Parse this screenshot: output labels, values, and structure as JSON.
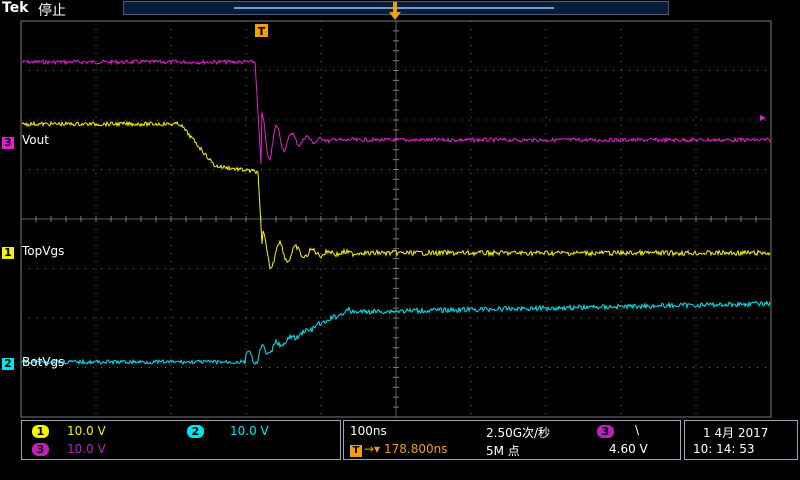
{
  "header": {
    "brand": "Tek",
    "run_state": "停止"
  },
  "trigger_marker_label": "T",
  "waveform_labels": {
    "ch3": "Vout",
    "ch1": "TopVgs",
    "ch2": "BotVgs"
  },
  "channel_markers": {
    "ch1": "1",
    "ch2": "2",
    "ch3": "3"
  },
  "colors": {
    "ch1": "#f5f500",
    "ch2": "#00e5f0",
    "ch3": "#e020d0",
    "trigger": "#f39c12",
    "graticule": "#6e6e6e"
  },
  "status": {
    "ch1": {
      "num": "1",
      "scale": "10.0 V"
    },
    "ch2": {
      "num": "2",
      "scale": "10.0 V"
    },
    "ch3": {
      "num": "3",
      "scale": "10.0 V"
    },
    "timebase": "100ns",
    "sample_rate": "2.50G次/秒",
    "trigger_delay": "178.800ns",
    "record_length": "5M 点",
    "trigger_source": "3",
    "trigger_slope": "\\",
    "trigger_level": "4.60 V",
    "date": "1 4月   2017",
    "time": "10: 14: 53"
  }
}
